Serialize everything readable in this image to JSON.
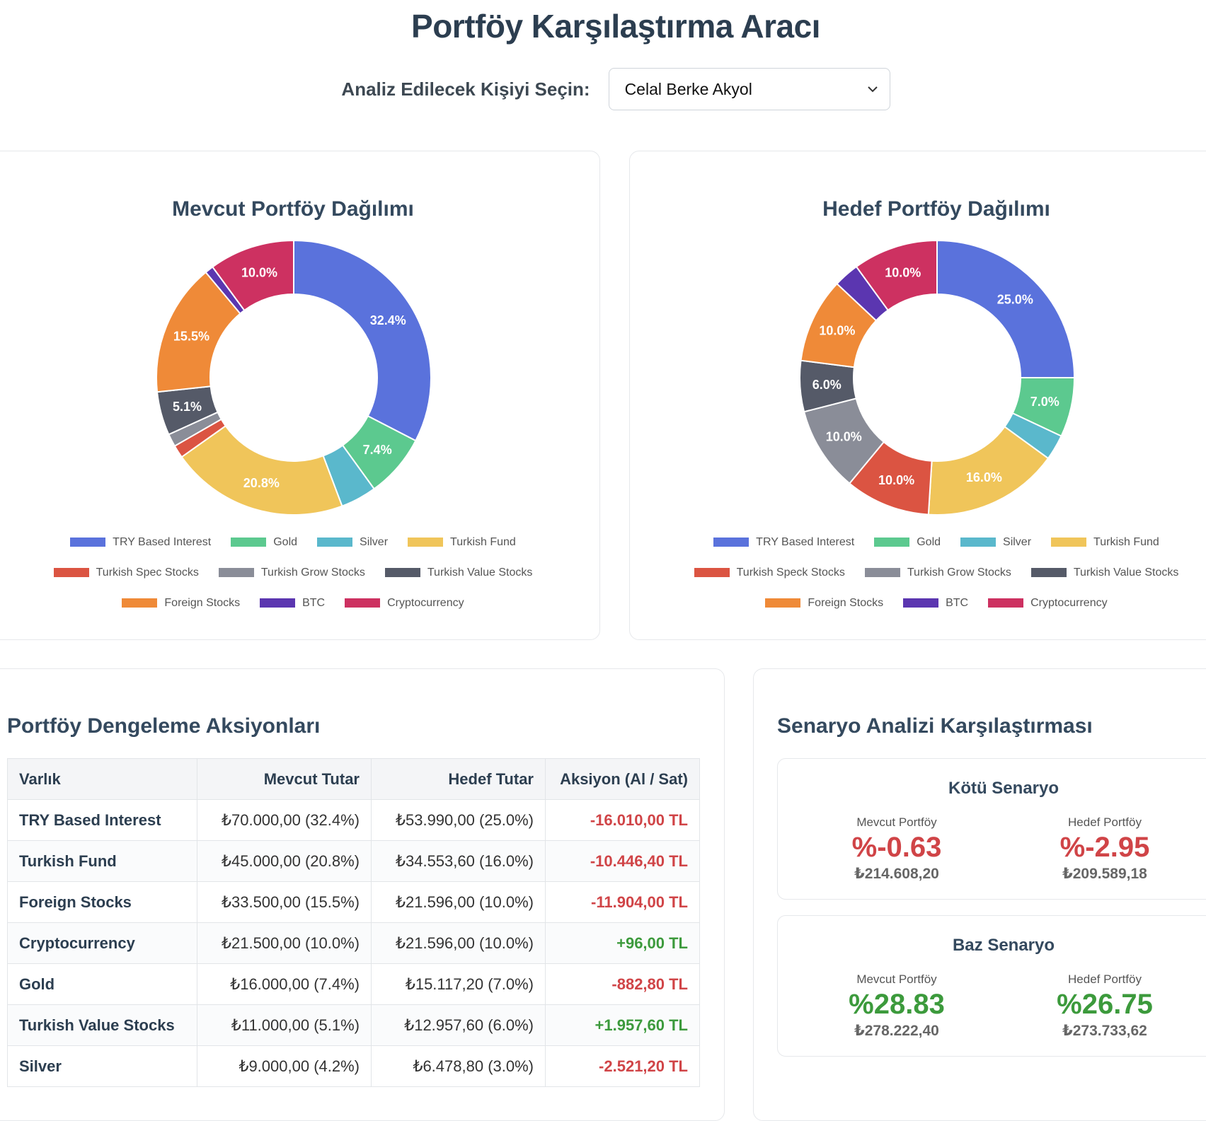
{
  "page": {
    "title": "Portföy Karşılaştırma Aracı"
  },
  "selector": {
    "label": "Analiz Edilecek Kişiyi Seçin:",
    "value": "Celal Berke Akyol"
  },
  "chart_data": [
    {
      "type": "pie",
      "title": "Mevcut Portföy Dağılımı",
      "categories": [
        "TRY Based Interest",
        "Gold",
        "Silver",
        "Turkish Fund",
        "Turkish Spec Stocks",
        "Turkish Grow Stocks",
        "Turkish Value Stocks",
        "Foreign Stocks",
        "BTC",
        "Cryptocurrency"
      ],
      "values": [
        32.4,
        7.4,
        4.2,
        20.8,
        1.5,
        1.5,
        5.1,
        15.5,
        1.0,
        10.0
      ],
      "value_labels": [
        "32.4%",
        "7.4%",
        "",
        "20.8%",
        "",
        "",
        "5.1%",
        "15.5%",
        "",
        "10.0%"
      ],
      "colors": [
        "#5a72dc",
        "#5cc98f",
        "#5ab8cc",
        "#f0c55a",
        "#db5442",
        "#8a8d98",
        "#555a68",
        "#ef8a38",
        "#5b36b0",
        "#cd3161"
      ],
      "legend_rows": [
        [
          0,
          1,
          2,
          3
        ],
        [
          4,
          5,
          6
        ],
        [
          7,
          8,
          9
        ]
      ]
    },
    {
      "type": "pie",
      "title": "Hedef Portföy Dağılımı",
      "categories": [
        "TRY Based Interest",
        "Gold",
        "Silver",
        "Turkish Fund",
        "Turkish Speck Stocks",
        "Turkish Grow Stocks",
        "Turkish Value Stocks",
        "Foreign Stocks",
        "BTC",
        "Cryptocurrency"
      ],
      "values": [
        25.0,
        7.0,
        3.0,
        16.0,
        10.0,
        10.0,
        6.0,
        10.0,
        3.0,
        10.0
      ],
      "value_labels": [
        "25.0%",
        "7.0%",
        "",
        "16.0%",
        "10.0%",
        "10.0%",
        "6.0%",
        "10.0%",
        "",
        "10.0%"
      ],
      "colors": [
        "#5a72dc",
        "#5cc98f",
        "#5ab8cc",
        "#f0c55a",
        "#db5442",
        "#8a8d98",
        "#555a68",
        "#ef8a38",
        "#5b36b0",
        "#cd3161"
      ],
      "legend_rows": [
        [
          0,
          1,
          2,
          3
        ],
        [
          4,
          5,
          6
        ],
        [
          7,
          8,
          9
        ]
      ]
    }
  ],
  "actions": {
    "title": "Portföy Dengeleme Aksiyonları",
    "headers": [
      "Varlık",
      "Mevcut Tutar",
      "Hedef Tutar",
      "Aksiyon (Al / Sat)"
    ],
    "rows": [
      {
        "asset": "TRY Based Interest",
        "current": "₺70.000,00 (32.4%)",
        "target": "₺53.990,00 (25.0%)",
        "action": "-16.010,00 TL",
        "sign": "neg"
      },
      {
        "asset": "Turkish Fund",
        "current": "₺45.000,00 (20.8%)",
        "target": "₺34.553,60 (16.0%)",
        "action": "-10.446,40 TL",
        "sign": "neg"
      },
      {
        "asset": "Foreign Stocks",
        "current": "₺33.500,00 (15.5%)",
        "target": "₺21.596,00 (10.0%)",
        "action": "-11.904,00 TL",
        "sign": "neg"
      },
      {
        "asset": "Cryptocurrency",
        "current": "₺21.500,00 (10.0%)",
        "target": "₺21.596,00 (10.0%)",
        "action": "+96,00 TL",
        "sign": "pos"
      },
      {
        "asset": "Gold",
        "current": "₺16.000,00 (7.4%)",
        "target": "₺15.117,20 (7.0%)",
        "action": "-882,80 TL",
        "sign": "neg"
      },
      {
        "asset": "Turkish Value Stocks",
        "current": "₺11.000,00 (5.1%)",
        "target": "₺12.957,60 (6.0%)",
        "action": "+1.957,60 TL",
        "sign": "pos"
      },
      {
        "asset": "Silver",
        "current": "₺9.000,00 (4.2%)",
        "target": "₺6.478,80 (3.0%)",
        "action": "-2.521,20 TL",
        "sign": "neg"
      }
    ]
  },
  "scenarios": {
    "title": "Senaryo Analizi Karşılaştırması",
    "items": [
      {
        "name": "Kötü Senaryo",
        "current_label": "Mevcut Portföy",
        "current_pct": "%-0.63",
        "current_amt": "₺214.608,20",
        "target_label": "Hedef Portföy",
        "target_pct": "%-2.95",
        "target_amt": "₺209.589,18",
        "tone": "red"
      },
      {
        "name": "Baz Senaryo",
        "current_label": "Mevcut Portföy",
        "current_pct": "%28.83",
        "current_amt": "₺278.222,40",
        "target_label": "Hedef Portföy",
        "target_pct": "%26.75",
        "target_amt": "₺273.733,62",
        "tone": "green"
      }
    ]
  },
  "icons": {
    "select_arrow": "chevron-down-icon"
  }
}
